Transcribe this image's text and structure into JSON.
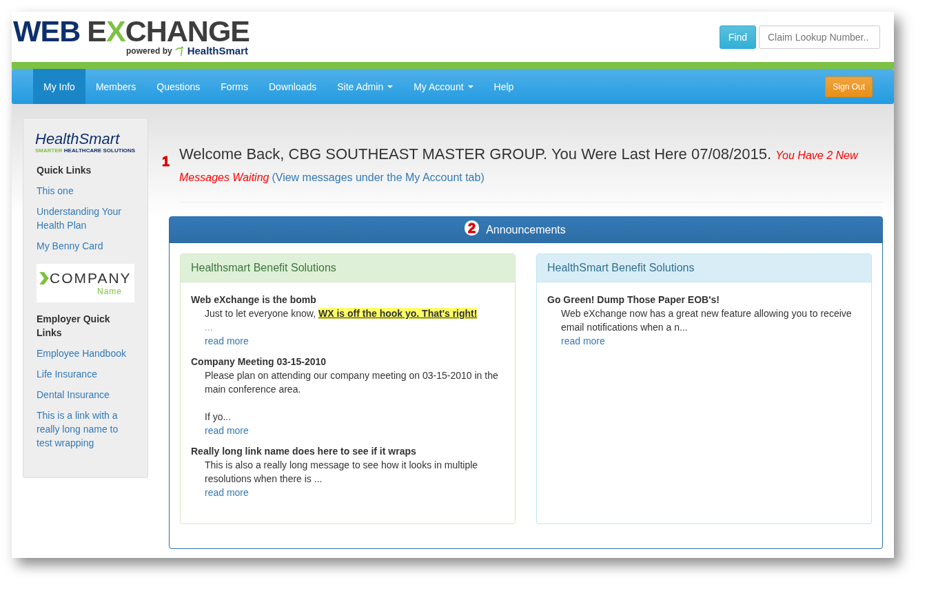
{
  "logo": {
    "parts": [
      {
        "text": "WEB",
        "color": "#0e2f6c"
      },
      {
        "text": "E",
        "color": "#3d3d3d"
      },
      {
        "text": "X",
        "color": "#7dc242"
      },
      {
        "text": "CHANGE",
        "color": "#3d3d3d"
      }
    ],
    "tagline": "powered by",
    "brand": "HealthSmart"
  },
  "search": {
    "button": "Find",
    "placeholder": "Claim Lookup Number.."
  },
  "nav": {
    "items": [
      {
        "label": "My Info",
        "selected": true,
        "dropdown": false
      },
      {
        "label": "Members",
        "selected": false,
        "dropdown": false
      },
      {
        "label": "Questions",
        "selected": false,
        "dropdown": false
      },
      {
        "label": "Forms",
        "selected": false,
        "dropdown": false
      },
      {
        "label": "Downloads",
        "selected": false,
        "dropdown": false
      },
      {
        "label": "Site Admin",
        "selected": false,
        "dropdown": true
      },
      {
        "label": "My Account",
        "selected": false,
        "dropdown": true
      },
      {
        "label": "Help",
        "selected": false,
        "dropdown": false
      }
    ],
    "sign_out": "Sign Out"
  },
  "sidebar": {
    "brand_logo": {
      "name": "HealthSmart",
      "tagline_1": "SMARTER",
      "tagline_2": "HEALTHCARE SOLUTIONS"
    },
    "quick_links_title": "Quick Links",
    "quick_links": [
      "This one",
      "Understanding Your Health Plan",
      "My Benny Card"
    ],
    "company_logo": {
      "name": "COMPANY",
      "sub": "Name"
    },
    "employer_title": "Employer Quick Links",
    "employer_links": [
      "Employee Handbook",
      "Life Insurance",
      "Dental Insurance",
      "This is a link with a really long name to test wrapping"
    ]
  },
  "callouts": [
    "1",
    "2"
  ],
  "welcome": {
    "text": "Welcome Back, CBG SOUTHEAST MASTER GROUP. You Were Last Here 07/08/2015.",
    "alert": "You Have 2 New Messages Waiting",
    "link": "(View messages under the My Account tab)"
  },
  "announcements": {
    "title": "Announcements",
    "panels": [
      {
        "title": "Healthsmart Benefit Solutions",
        "color": "#dff0d8",
        "posts": [
          {
            "title": "Web eXchange is the bomb",
            "text": "Just to let everyone know, ",
            "highlight": "WX is off the hook yo.  That's right!",
            "tail": "...",
            "more": "read more"
          },
          {
            "title": "Company Meeting 03-15-2010",
            "text": "Please plan on attending our company meeting on 03-15-2010 in the main conference area.\n\nIf yo...",
            "more": "read more"
          },
          {
            "title": "Really long link name does here to see if it wraps",
            "text": "This is also a really long message to see how it looks in multiple resolutions when there is ...",
            "more": "read more"
          }
        ]
      },
      {
        "title": "HealthSmart Benefit Solutions",
        "color": "#d9edf7",
        "posts": [
          {
            "title": "Go Green! Dump Those Paper EOB's!",
            "text": "Web eXchange now has a great new feature allowing you to receive email notifications when a n...",
            "more": "read more"
          }
        ]
      }
    ]
  }
}
